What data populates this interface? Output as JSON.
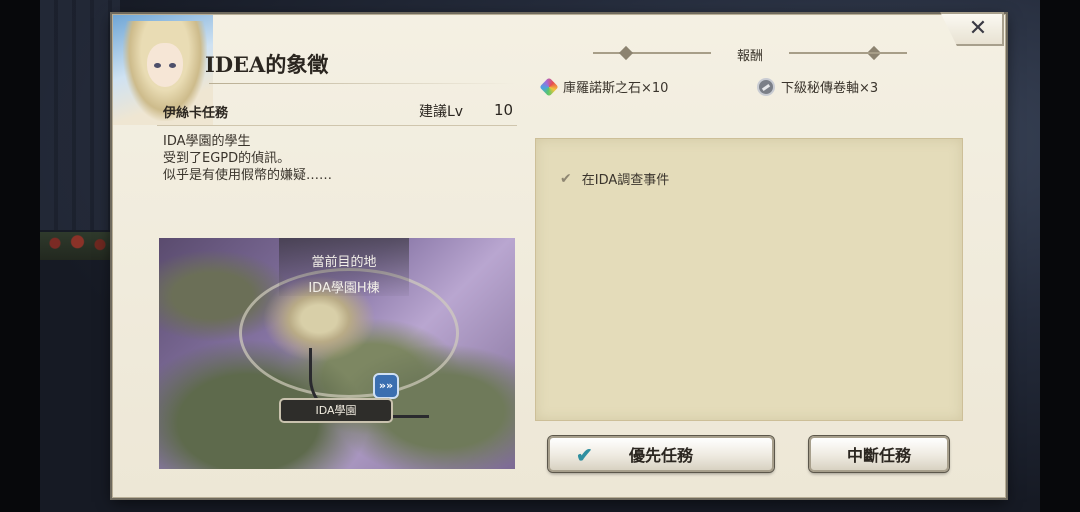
{
  "dialog": {
    "title": "IDEA的象徵",
    "quest_name": "伊絲卡任務",
    "recommended_label": "建議Lv",
    "recommended_level": "10",
    "description": [
      "IDA學園的學生",
      "受到了EGPD的偵訊。",
      "似乎是有使用假幣的嫌疑……"
    ]
  },
  "map": {
    "destination_label": "當前目的地",
    "destination_name": "IDA學園H棟",
    "marker_glyph": "»»",
    "location_tag": "IDA學園"
  },
  "rewards": {
    "title": "報酬",
    "items": [
      {
        "icon": "rainbow-stone-icon",
        "label": "庫羅諾斯之石×10"
      },
      {
        "icon": "scroll-icon",
        "label": "下級秘傳卷軸×3"
      }
    ]
  },
  "objectives": [
    {
      "icon": "check-icon",
      "text": "在IDA調查事件"
    }
  ],
  "buttons": {
    "priority_label": "優先任務",
    "abort_label": "中斷任務"
  },
  "close_glyph": "✕"
}
